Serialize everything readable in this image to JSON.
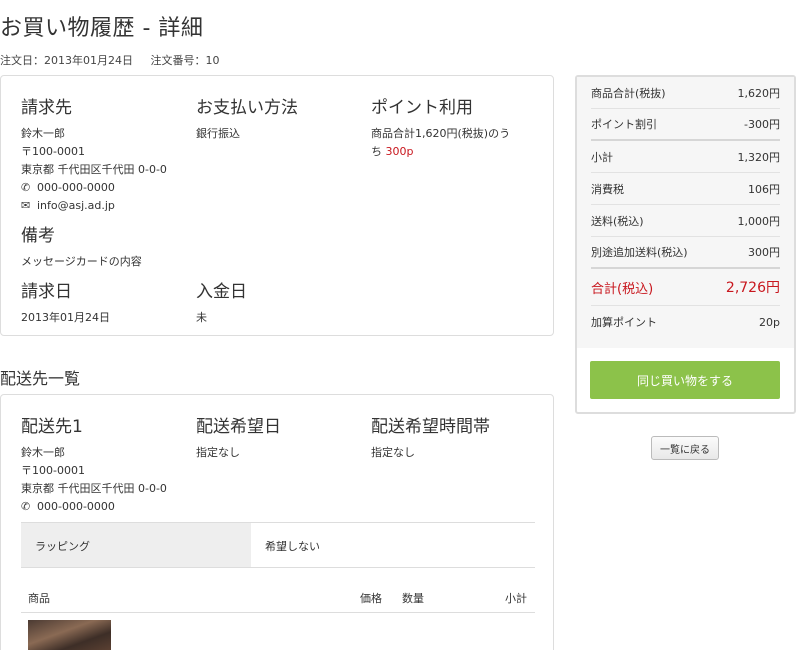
{
  "page": {
    "title": "お買い物履歴 - 詳細",
    "order_date": "注文日：2013年01月24日",
    "order_number": "注文番号：10"
  },
  "billing": {
    "heading": "請求先",
    "name": "鈴木一郎",
    "zip": "〒100-0001",
    "address": "東京都 千代田区千代田 0-0-0",
    "phone": "000-000-0000",
    "email": "info@asj.ad.jp",
    "phone_icon": "phone-icon",
    "mail_icon": "mail-icon"
  },
  "payment": {
    "heading": "お支払い方法",
    "method": "銀行振込"
  },
  "points": {
    "heading": "ポイント利用",
    "text_line1": "商品合計1,620円(税抜)のう",
    "text_line2_prefix": "ち ",
    "used": "300p"
  },
  "remarks": {
    "heading": "備考",
    "text": "メッセージカードの内容"
  },
  "invoice": {
    "heading": "請求日",
    "date": "2013年01月24日"
  },
  "deposit": {
    "heading": "入金日",
    "value": "未"
  },
  "delivery_list": {
    "title": "配送先一覧",
    "destination": {
      "heading": "配送先1",
      "name": "鈴木一郎",
      "zip": "〒100-0001",
      "address": "東京都 千代田区千代田 0-0-0",
      "phone": "000-000-0000"
    },
    "date": {
      "heading": "配送希望日",
      "value": "指定なし"
    },
    "time": {
      "heading": "配送希望時間帯",
      "value": "指定なし"
    },
    "wrapping": {
      "label": "ラッピング",
      "value": "希望しない"
    },
    "items_header": {
      "product": "商品",
      "price": "価格",
      "quantity": "数量",
      "subtotal": "小計"
    }
  },
  "summary": {
    "rows": [
      {
        "label": "商品合計(税抜)",
        "value": "1,620円"
      },
      {
        "label": "ポイント割引",
        "value": "-300円"
      },
      {
        "label": "小計",
        "value": "1,320円"
      },
      {
        "label": "消費税",
        "value": "106円"
      },
      {
        "label": "送料(税込)",
        "value": "1,000円"
      },
      {
        "label": "別途追加送料(税込)",
        "value": "300円"
      },
      {
        "label": "合計(税込)",
        "value": "2,726円"
      },
      {
        "label": "加算ポイント",
        "value": "20p"
      }
    ],
    "repeat_button": "同じ買い物をする",
    "total_color": "#c8171e",
    "button_color": "#8cc24a"
  },
  "back_button": "一覧に戻る"
}
